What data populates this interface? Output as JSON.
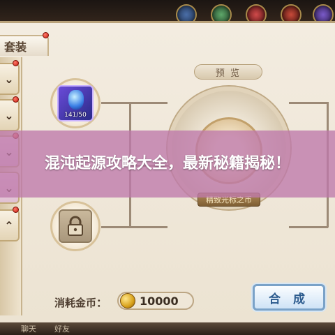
{
  "tab": {
    "label": "套装"
  },
  "side_buttons": [
    {
      "icon": "chevron-down-icon",
      "glyph": "⌄"
    },
    {
      "icon": "chevron-down-icon",
      "glyph": "⌄"
    },
    {
      "icon": "chevron-down-icon",
      "glyph": "⌄"
    },
    {
      "icon": "chevron-down-icon",
      "glyph": "⌄"
    },
    {
      "icon": "chevron-up-icon",
      "glyph": "⌃"
    }
  ],
  "slots": {
    "gem": {
      "icon": "gem-icon",
      "count": "141/50"
    },
    "locked": {
      "icon": "lock-icon"
    }
  },
  "preview": {
    "banner_label": "预 览",
    "emblem_label": "精致光标之币"
  },
  "cost": {
    "label": "消耗金币：",
    "value": "10000",
    "icon": "coin-icon"
  },
  "compose_button": {
    "label": "合 成"
  },
  "bottom_bar": {
    "items": [
      "聊天",
      "好友"
    ]
  },
  "overlay": {
    "title": "混沌起源攻略大全，最新秘籍揭秘！"
  },
  "colors": {
    "overlay": "#be78aa",
    "panel": "#f3ece0",
    "button_border": "#7aa2c8",
    "notification_dot": "#c81e10"
  }
}
